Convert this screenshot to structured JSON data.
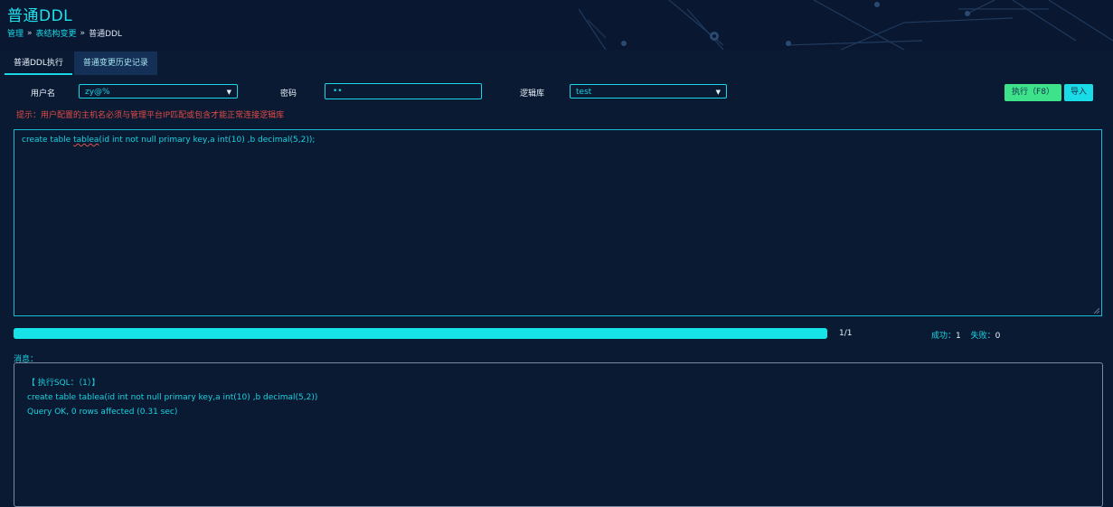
{
  "header": {
    "title": "普通DDL",
    "breadcrumb": [
      "管理",
      "表结构变更",
      "普通DDL"
    ],
    "separator": "»"
  },
  "tabs": [
    {
      "label": "普通DDL执行",
      "active": true
    },
    {
      "label": "普通变更历史记录",
      "active": false
    }
  ],
  "form": {
    "user_label": "用户名",
    "user_value": "zy@%",
    "password_label": "密码",
    "password_value": "••",
    "db_label": "逻辑库",
    "db_value": "test",
    "execute_button": "执行（F8）",
    "import_button": "导入"
  },
  "hint": "提示：用户配置的主机名必须与管理平台IP匹配或包含才能正常连接逻辑库",
  "editor": {
    "sql_prefix": "create table ",
    "sql_flagged": "tablea",
    "sql_suffix": "(id int not null primary key,a int(10) ,b decimal(5,2));"
  },
  "progress": {
    "fraction": 1.0,
    "count_text": "1/1",
    "success_label": "成功：",
    "success_value": "1",
    "fail_label": "失败：",
    "fail_value": "0"
  },
  "messages": {
    "label": "消息：",
    "lines": [
      "【 执行SQL：（1）】",
      "create table tablea(id int not null primary key,a int(10) ,b decimal(5,2))",
      "Query OK, 0 rows affected (0.31 sec)"
    ]
  },
  "colors": {
    "background": "#0b1a33",
    "accent": "#1ad7e6",
    "execute_green": "#3ee28a",
    "hint_red": "#e04b45"
  }
}
